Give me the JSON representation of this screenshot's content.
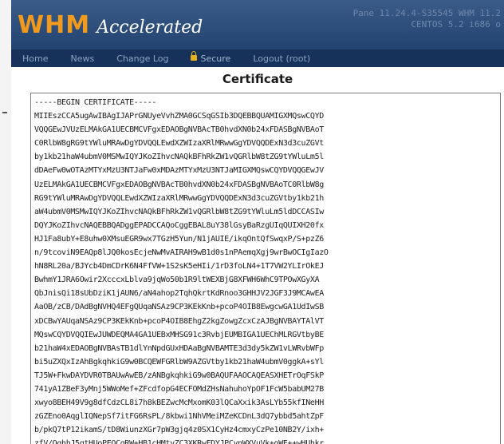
{
  "header": {
    "logo_main": "WHM",
    "logo_sub": "Accelerated",
    "server_line1": "Pane 11.24.4-S35545   WHM 11.2",
    "server_line2": "CENTOS 5.2 i686 o"
  },
  "nav": {
    "items": [
      {
        "label": "Home"
      },
      {
        "label": "News"
      },
      {
        "label": "Change Log"
      },
      {
        "label": "Secure",
        "icon": "lock-icon"
      },
      {
        "label": "Logout (root)"
      }
    ]
  },
  "page": {
    "title": "Certificate"
  },
  "certificate": {
    "text": "-----BEGIN CERTIFICATE-----\nMIIEszCCA5ugAwIBAgIJAPrGNUyeVvhZMA0GCSqGSIb3DQEBBQUAMIGXMQswCQYD\nVQQGEwJVUzELMAkGA1UECBMCVFgxEDAOBgNVBAcTB0hvdXN0b24xFDASBgNVBAoT\nC0RlbW8gRG9tYWluMRAwDgYDVQQLEwdXZWIzaXRlMRwwGgYDVQQDExN3d3cuZGVt\nby1kb21haW4ubmV0MSMwIQYJKoZIhvcNAQkBFhRkZW1vQGRlbW8tZG9tYWluLm5l\ndDAeFw0wOTAzMTYxMzU3NTJaFw0xMDAzMTYxMzU3NTJaMIGXMQswCQYDVQQGEwJV\nUzELMAkGA1UECBMCVFgxEDAOBgNVBAcTB0hvdXN0b24xFDASBgNVBAoTC0RlbW8g\nRG9tYWluMRAwDgYDVQQLEwdXZWIzaXRlMRwwGgYDVQQDExN3d3cuZGVtby1kb21h\naW4ubmV0MSMwIQYJKoZIhvcNAQkBFhRkZW1vQGRlbW8tZG9tYWluLm5ldDCCASIw\nDQYJKoZIhvcNAQEBBQADggEPADCCAQoCggEBAL8uY38lGsyBaRzgUIqQUIXH20fx\nHJ1Fa8ubY+E8uhw0XMsuEGR9wx7TGzH5Yun/N1jAUIE/ikqOntQfSwqxP/S+pzZ6\nn/9tcoviN9EAQp8lJQ0kosEcjeNwMvAIRAH9wB1d0s1nPAemqXgj9wrBwOCIgIazO\nhN8RL20a/BJYcb4DmCDrK6N4FfVW+1S2sK5eHIi/1rD3foLN4+1T7VW2YLIrOkEJ\nBwhmY1JRA6Owir2XcccxLblva9jqWo50b1R9ltWEXBjG8XFWH6WhC9TPOwXGyXA\nQbJnisQi18sUbDziK1jAUN6/aN4ahop2TqhQkrtKdRnoo3GHHJV2JGF3J9MCAwEA\nAaOB/zCB/DAdBgNVHQ4EFgQUqaNSAz9CP3KEkKnb+pcoP4OIB8EwgcwGA1UdIwSB\nxDCBwYAUqaNSAz9CP3KEkKnb+pcoP4OIB8EhgZ2kgZowgZcxCzAJBgNVBAYTAlVT\nMQswCQYDVQQIEwJUWDEQMA4GA1UEBxMHSG91c3RvbjEUMBIGA1UEChMLRGVtbyBE\nb21haW4xEDAOBgNVBAsTB1dlYnNpdGUxHDAaBgNVBAMTE3d3dy5kZW1vLWRvbWFp\nbi5uZXQxIzAhBgkqhkiG9w0BCQEWFGRlbW9AZGVtby1kb21haW4ubmV0ggkA+sYl\nTJ5W+FkwDAYDVR0TBAUwAwEB/zANBgkqhkiG9w0BAQUFAAOCAQEASXHETrOqFSkP\n741yA1ZBeF3yMnj5WWoMef+ZFcdfopG4ECFOMdZHsNahuhoYpOF1FcW5babUM27B\nxwyo8BEH49V9g8dfCdzCL8i7h8kBEZwcMcMxomK03lQCaXxik3AsLYb55kfINeHH\nzGZEno0AqglIQNepSf7itFG6RsPL/8kbwi1NhVMeiMZeKCDnL3dQ7ybbd5ahtZpF\nb/pkQ7tP12ikamS/tD8WiunzXGr7pW3gjq4z0SX1CyHz4cmxyCzPe10NB2Y/ixh+\nzfV/OghhJ5qtHUoPEOCgRW+HB1cHMtvZC3XKRwFDYJPCynWXVuVk+oWE++wHUhkr"
  }
}
